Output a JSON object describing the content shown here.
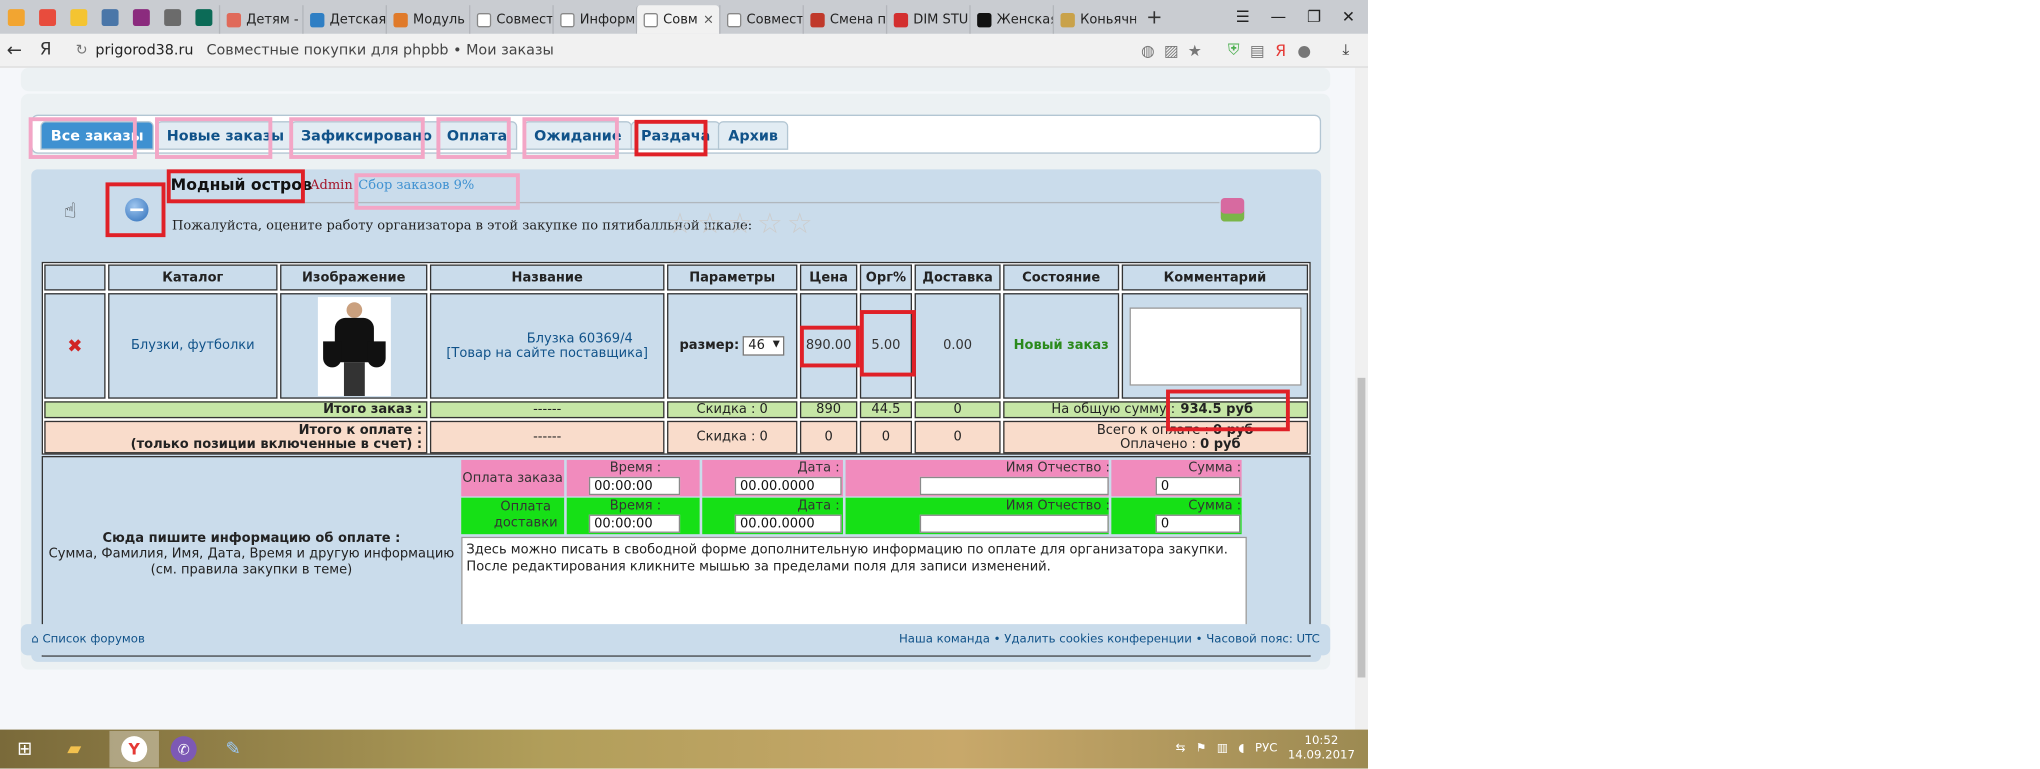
{
  "browser": {
    "tabs": [
      "Детям -",
      "Детская",
      "Модуль",
      "Совмест",
      "Информ",
      "Совм",
      "Совмест",
      "Смена п",
      "DIM STU",
      "Женская",
      "Коньячн"
    ],
    "active_tab_index": 5,
    "close_glyph": "×",
    "new_tab_glyph": "+",
    "back_glyph": "←",
    "yandex_glyph": "Я",
    "host": "prigorod38.ru",
    "page_title": "Совместные покупки для phpbb • Мои заказы"
  },
  "order_tabs": [
    "Все заказы",
    "Новые заказы",
    "Зафиксировано",
    "Оплата",
    "Ожидание",
    "Раздача",
    "Архив"
  ],
  "order_header": {
    "shop": "Модный остров",
    "admin": "Admin",
    "collection": "Сбор заказов 9%",
    "rating_prompt": "Пожалуйста, оцените работу организатора в этой закупке по пятибалльной шкале:"
  },
  "table": {
    "headers": [
      "Каталог",
      "Изображение",
      "Название",
      "Параметры",
      "Цена",
      "Орг%",
      "Доставка",
      "Состояние",
      "Комментарий"
    ],
    "row": {
      "delete_glyph": "✖",
      "catalog": "Блузки, футболки",
      "name_line1": "Блузка 60369/4",
      "name_line2": "[Товар на сайте поставщика]",
      "param_label": "размер:",
      "param_value": "46",
      "price": "890.00",
      "org": "5.00",
      "delivery": "0.00",
      "status": "Новый заказ"
    },
    "total_order": {
      "label": "Итого заказ :",
      "dashes": "------",
      "discount": "Скидка : 0",
      "price": "890",
      "org": "44.5",
      "delivery": "0",
      "sum_label": "На общую сумму :",
      "sum_value": "934.5 руб"
    },
    "total_pay": {
      "label_line1": "Итого к оплате :",
      "label_line2": "(только позиции включенные в счет) :",
      "dashes": "------",
      "discount": "Скидка : 0",
      "price": "0",
      "org": "0",
      "delivery": "0",
      "total_label": "Всего к оплате :",
      "total_value": "0 руб",
      "paid_label": "Оплачено :",
      "paid_value": "0 руб"
    }
  },
  "payment": {
    "info_title": "Сюда пишите информацию об оплате :",
    "info_line1": "Сумма, Фамилия, Имя, Дата, Время и другую информацию",
    "info_line2": "(см. правила закупки в теме)",
    "order_label": "Оплата заказа",
    "delivery_label_1": "Оплата",
    "delivery_label_2": "доставки",
    "time_label": "Время :",
    "date_label": "Дата :",
    "name_label": "Имя Отчество :",
    "sum_label": "Сумма :",
    "time_value": "00:00:00",
    "date_value": "00.00.0000",
    "sum_value": "0",
    "note_line1": "Здесь можно писать в свободной форме дополнительную информацию по оплате для организатора закупки.",
    "note_line2": "После редактирования кликните мышью за пределами поля для записи изменений."
  },
  "footer": {
    "left": "Список форумов",
    "right": "Наша команда • Удалить cookies конференции • Часовой пояс: UTC"
  },
  "taskbar": {
    "lang": "РУС",
    "time": "10:52",
    "date": "14.09.2017"
  },
  "colors": {
    "accent": "#3f91d1",
    "link": "#105289",
    "mark_red": "#e02027",
    "mark_pink": "#f3a6c6",
    "status_green": "#2b8a1c"
  }
}
